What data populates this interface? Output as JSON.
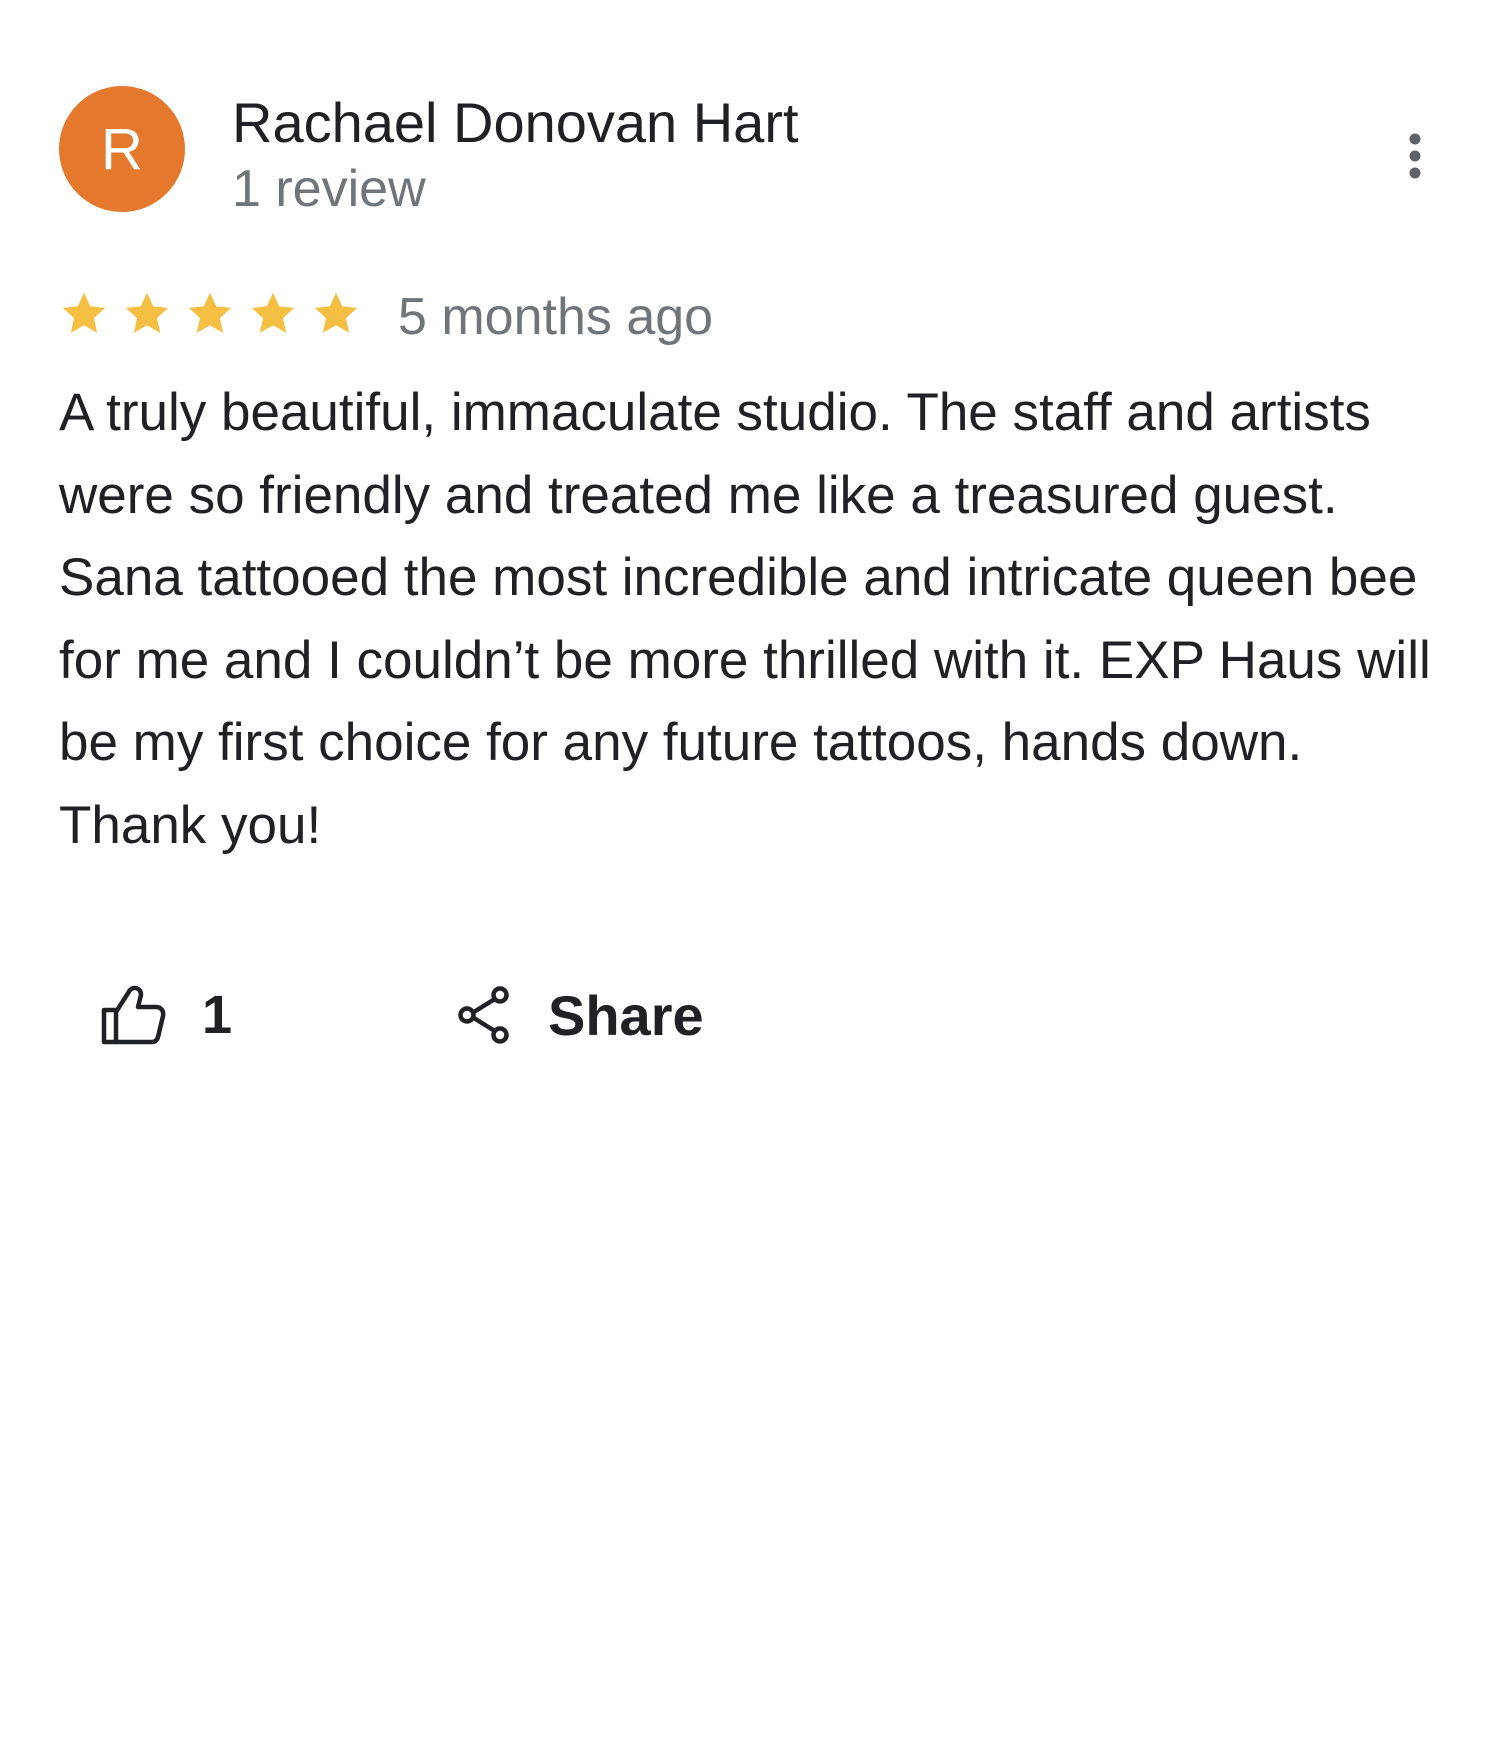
{
  "reviewer": {
    "initial": "R",
    "avatar_color": "#e4792d",
    "name": "Rachael Donovan Hart",
    "review_count": "1 review"
  },
  "menu": {
    "icon": "more-vert-icon"
  },
  "review": {
    "rating": 5,
    "rating_max": 5,
    "star_color": "#f4bf42",
    "time": "5 months ago",
    "text": "A truly beautiful, immaculate studio. The staff and artists were so friendly and treated me like a treasured guest. Sana tattooed the most incredible and intricate queen bee for me and I couldn’t be more thrilled with it. EXP Haus will be my first choice for any future tattoos, hands down. Thank you!"
  },
  "actions": {
    "like_icon": "thumbs-up-icon",
    "like_count": "1",
    "share_icon": "share-icon",
    "share_label": "Share"
  }
}
